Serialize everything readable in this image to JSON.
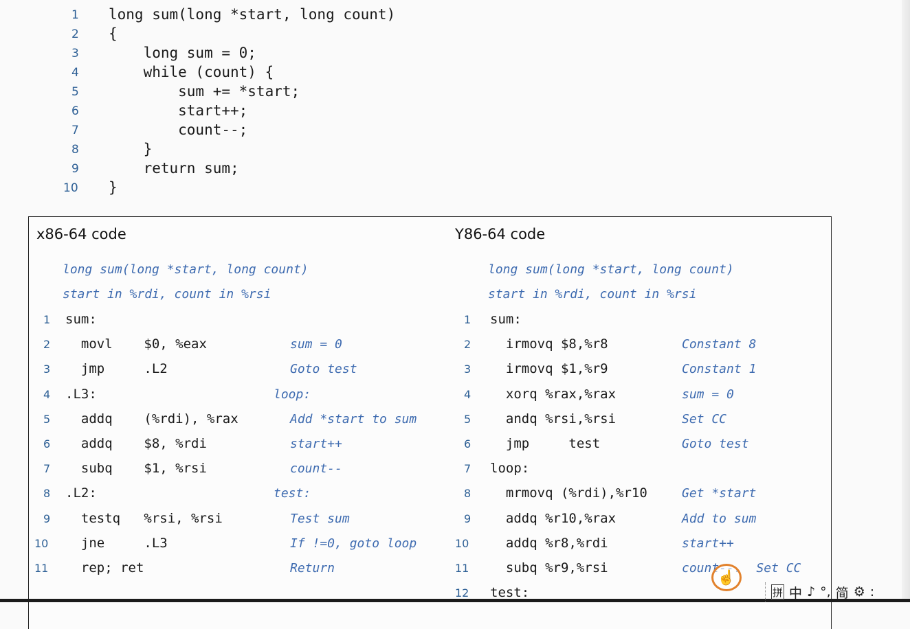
{
  "source": {
    "lines": [
      {
        "n": "1",
        "text": "long sum(long *start, long count)"
      },
      {
        "n": "2",
        "text": "{"
      },
      {
        "n": "3",
        "text": "    long sum = 0;"
      },
      {
        "n": "4",
        "text": "    while (count) {"
      },
      {
        "n": "5",
        "text": "        sum += *start;"
      },
      {
        "n": "6",
        "text": "        start++;"
      },
      {
        "n": "7",
        "text": "        count--;"
      },
      {
        "n": "8",
        "text": "    }"
      },
      {
        "n": "9",
        "text": "    return sum;"
      },
      {
        "n": "10",
        "text": "}"
      }
    ]
  },
  "x86": {
    "title": "x86-64 code",
    "sig": "long sum(long *start, long count)",
    "regs": "start in %rdi, count in %rsi",
    "lines": [
      {
        "n": "1",
        "text": "sum:",
        "cmt": ""
      },
      {
        "n": "2",
        "text": "  movl    $0, %eax",
        "cmt": "sum = 0"
      },
      {
        "n": "3",
        "text": "  jmp     .L2",
        "cmt": "Goto test"
      },
      {
        "n": "4",
        "text": ".L3:",
        "cmt": "loop:"
      },
      {
        "n": "5",
        "text": "  addq    (%rdi), %rax",
        "cmt": "Add *start to sum"
      },
      {
        "n": "6",
        "text": "  addq    $8, %rdi",
        "cmt": "start++"
      },
      {
        "n": "7",
        "text": "  subq    $1, %rsi",
        "cmt": "count--"
      },
      {
        "n": "8",
        "text": ".L2:",
        "cmt": "test:"
      },
      {
        "n": "9",
        "text": "  testq   %rsi, %rsi",
        "cmt": "Test sum"
      },
      {
        "n": "10",
        "text": "  jne     .L3",
        "cmt": "If !=0, goto loop"
      },
      {
        "n": "11",
        "text": "  rep; ret",
        "cmt": "Return"
      }
    ]
  },
  "y86": {
    "title": "Y86-64 code",
    "sig": "long sum(long *start, long count)",
    "regs": "start in %rdi, count in %rsi",
    "lines": [
      {
        "n": "1",
        "text": "sum:",
        "cmt": ""
      },
      {
        "n": "2",
        "text": "  irmovq $8,%r8",
        "cmt": "Constant 8"
      },
      {
        "n": "3",
        "text": "  irmovq $1,%r9",
        "cmt": "Constant 1"
      },
      {
        "n": "4",
        "text": "  xorq %rax,%rax",
        "cmt": "sum = 0"
      },
      {
        "n": "5",
        "text": "  andq %rsi,%rsi",
        "cmt": "Set CC"
      },
      {
        "n": "6",
        "text": "  jmp     test",
        "cmt": "Goto test"
      },
      {
        "n": "7",
        "text": "loop:",
        "cmt": ""
      },
      {
        "n": "8",
        "text": "  mrmovq (%rdi),%r10",
        "cmt": "Get *start"
      },
      {
        "n": "9",
        "text": "  addq %r10,%rax",
        "cmt": "Add to sum"
      },
      {
        "n": "10",
        "text": "  addq %r8,%rdi",
        "cmt": "start++"
      },
      {
        "n": "11",
        "text": "  subq %r9,%rsi",
        "cmt": "count--.  Set CC"
      },
      {
        "n": "12",
        "text": "test:",
        "cmt": ""
      }
    ]
  },
  "overlay": {
    "cursor_glyph": "☝",
    "ime_chars": [
      "拼",
      "中",
      "♪",
      "°,",
      "简",
      "⚙",
      ":"
    ]
  },
  "colors": {
    "line_number": "#2d5f95",
    "comment": "#3e6bb0",
    "cursor_ring": "#e2822d"
  }
}
